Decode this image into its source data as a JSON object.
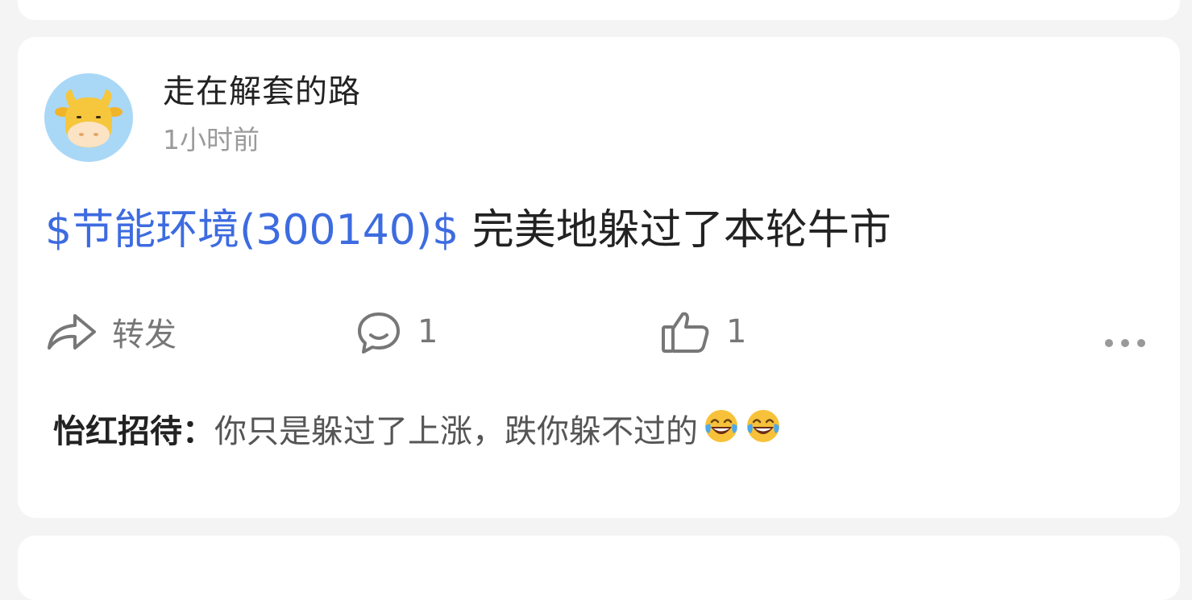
{
  "post": {
    "username": "走在解套的路",
    "timestamp": "1小时前",
    "stock_tag": "$节能环境(300140)$",
    "text": " 完美地躲过了本轮牛市"
  },
  "actions": {
    "forward_label": "转发",
    "comment_count": "1",
    "like_count": "1"
  },
  "comment": {
    "author": "怡红招待：",
    "text": "你只是躲过了上涨，跌你躲不过的",
    "emojis": [
      "face-with-tears-of-joy",
      "face-with-tears-of-joy"
    ]
  },
  "colors": {
    "background": "#f4f4f4",
    "card": "#ffffff",
    "link_blue": "#3d6be0",
    "avatar_bg": "#a9d8f7",
    "cow_yellow": "#f6c63c"
  }
}
